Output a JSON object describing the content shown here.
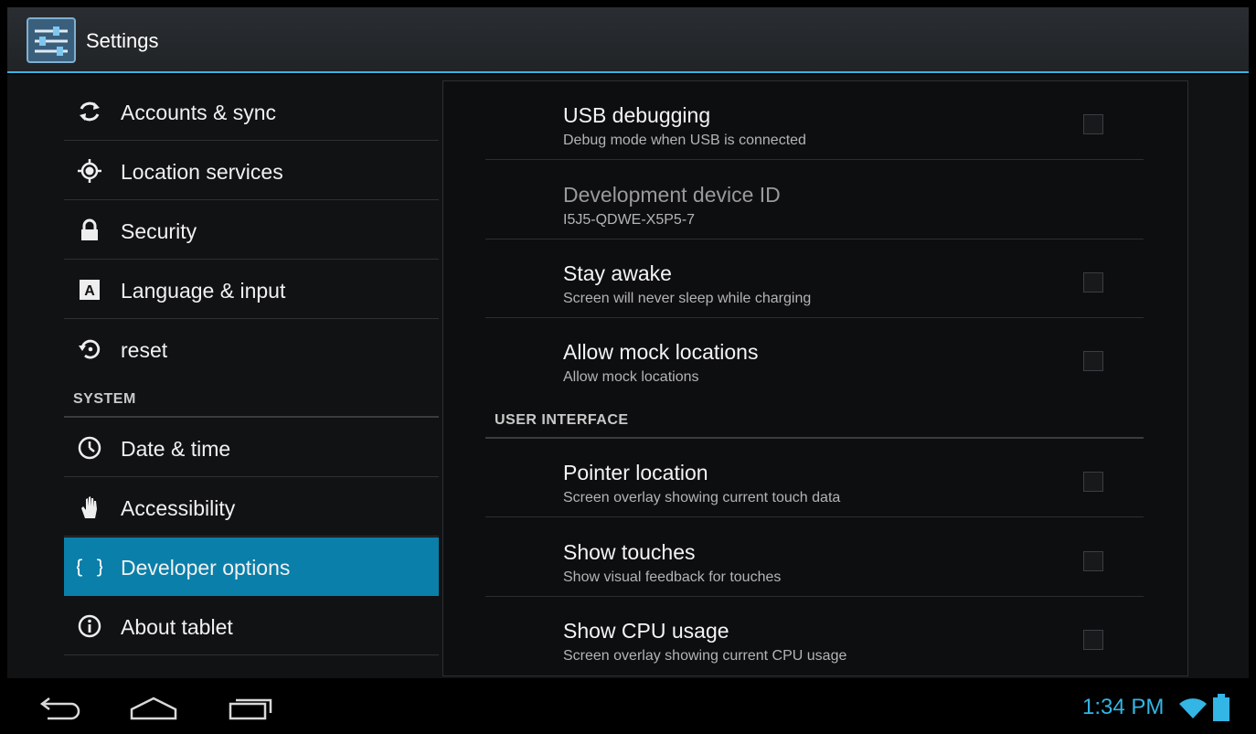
{
  "action_bar": {
    "title": "Settings"
  },
  "left_list": {
    "items_top": [
      {
        "label": "Accounts & sync",
        "icon": "sync-icon"
      },
      {
        "label": "Location services",
        "icon": "location-icon"
      },
      {
        "label": "Security",
        "icon": "lock-icon"
      },
      {
        "label": "Language & input",
        "icon": "language-icon"
      },
      {
        "label": "reset",
        "icon": "reset-icon"
      }
    ],
    "section_system": "SYSTEM",
    "items_system": [
      {
        "label": "Date & time",
        "icon": "clock-icon"
      },
      {
        "label": "Accessibility",
        "icon": "hand-icon"
      },
      {
        "label": "Developer options",
        "icon": "braces-icon",
        "selected": true
      },
      {
        "label": "About tablet",
        "icon": "info-icon"
      }
    ]
  },
  "right_pane": {
    "prefs_top": [
      {
        "title": "USB debugging",
        "summary": "Debug mode when USB is connected",
        "checked": false
      },
      {
        "title": "Development device ID",
        "summary": "I5J5-QDWE-X5P5-7",
        "disabled": true
      },
      {
        "title": "Stay awake",
        "summary": "Screen will never sleep while charging",
        "checked": false
      },
      {
        "title": "Allow mock locations",
        "summary": "Allow mock locations",
        "checked": false
      }
    ],
    "section_ui": "USER INTERFACE",
    "prefs_ui": [
      {
        "title": "Pointer location",
        "summary": "Screen overlay showing current touch data",
        "checked": false
      },
      {
        "title": "Show touches",
        "summary": "Show visual feedback for touches",
        "checked": false
      },
      {
        "title": "Show CPU usage",
        "summary": "Screen overlay showing current CPU usage",
        "checked": false
      }
    ]
  },
  "nav_bar": {
    "buttons": [
      "back-icon",
      "home-icon",
      "recent-apps-icon"
    ],
    "time": "1:34 PM",
    "status_icons": [
      "wifi-icon",
      "battery-icon"
    ]
  },
  "colors": {
    "accent": "#33b5e5",
    "selected": "#0a7fa9",
    "background": "#111214"
  }
}
